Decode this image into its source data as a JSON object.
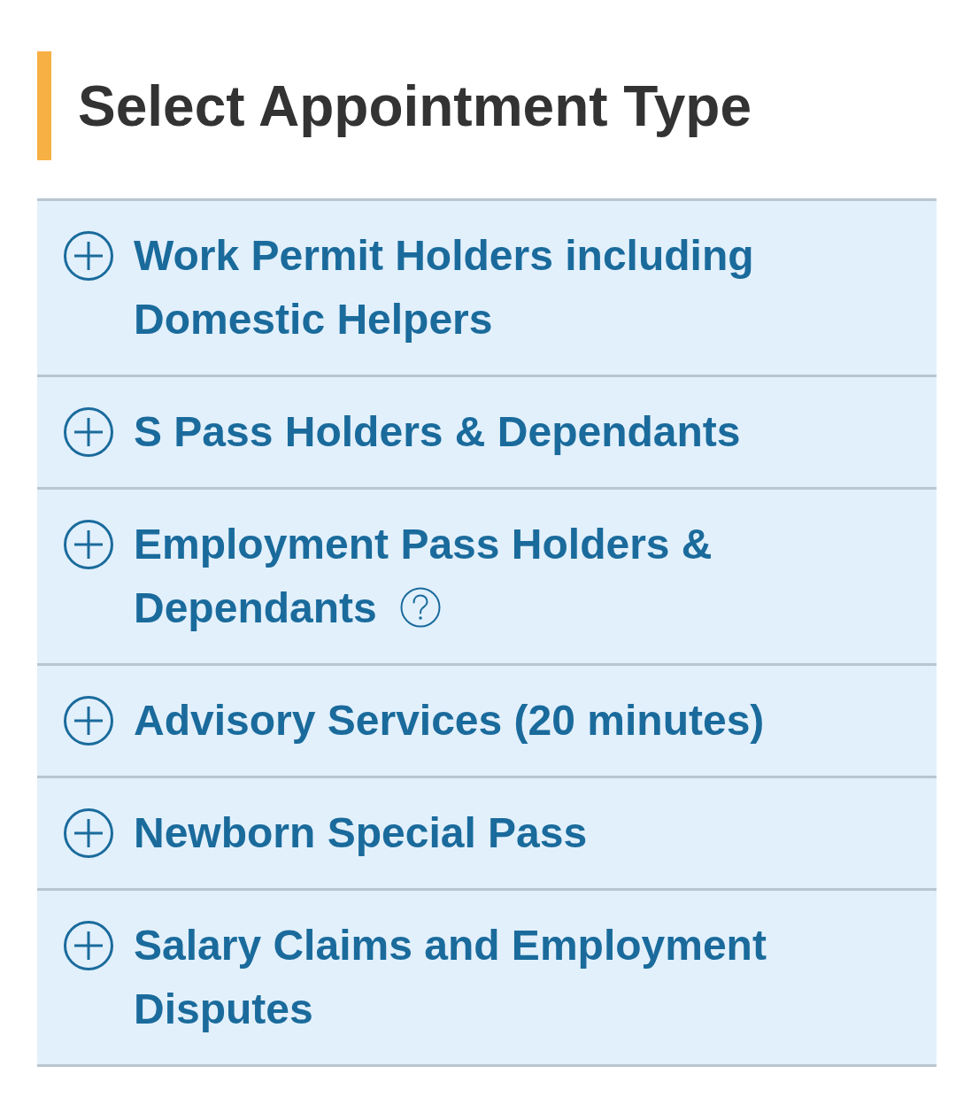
{
  "heading": {
    "title": "Select Appointment Type"
  },
  "appointment_types": [
    {
      "label": "Work Permit Holders including Domestic Helpers",
      "expanded": false,
      "help_icon": false
    },
    {
      "label": "S Pass Holders & Dependants",
      "expanded": false,
      "help_icon": false
    },
    {
      "label": "Employment Pass Holders & Dependants",
      "expanded": false,
      "help_icon": true
    },
    {
      "label": "Advisory Services (20 minutes)",
      "expanded": false,
      "help_icon": false
    },
    {
      "label": "Newborn Special Pass",
      "expanded": false,
      "help_icon": false
    },
    {
      "label": "Salary Claims and Employment Disputes",
      "expanded": false,
      "help_icon": false
    }
  ]
}
